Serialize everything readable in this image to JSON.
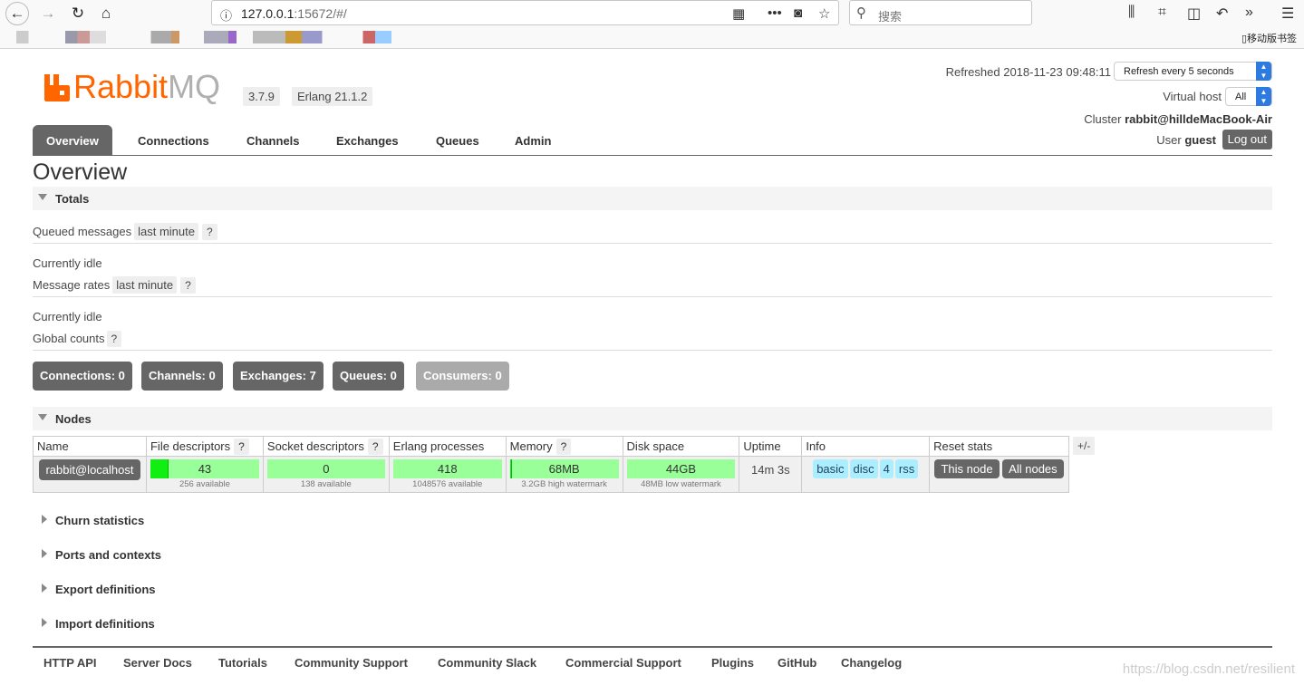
{
  "browser": {
    "url_host": "127.0.0.1",
    "url_rest": ":15672/#/",
    "search_placeholder": "搜索",
    "mobile_bookmarks": "移动版书签"
  },
  "header": {
    "brand": "Rabbit",
    "brand_suffix": "MQ",
    "version": "3.7.9",
    "erlang": "Erlang 21.1.2",
    "refreshed": "Refreshed 2018-11-23 09:48:11",
    "refresh_option": "Refresh every 5 seconds",
    "vhost_label": "Virtual host",
    "vhost_option": "All",
    "cluster_label": "Cluster ",
    "cluster_name": "rabbit@hilldeMacBook-Air",
    "user_label": "User ",
    "user_name": "guest",
    "logout": "Log out"
  },
  "tabs": [
    "Overview",
    "Connections",
    "Channels",
    "Exchanges",
    "Queues",
    "Admin"
  ],
  "page_title": "Overview",
  "totals": {
    "title": "Totals",
    "queued_label": "Queued messages",
    "queued_range": "last minute",
    "help": "?",
    "idle1": "Currently idle",
    "rates_label": "Message rates",
    "rates_range": "last minute",
    "idle2": "Currently idle",
    "global_label": "Global counts",
    "counts": {
      "connections": "Connections: ",
      "connections_v": "0",
      "channels": "Channels: ",
      "channels_v": "0",
      "exchanges": "Exchanges: ",
      "exchanges_v": "7",
      "queues": "Queues: ",
      "queues_v": "0",
      "consumers": "Consumers: ",
      "consumers_v": "0"
    }
  },
  "nodes": {
    "title": "Nodes",
    "headers": [
      "Name",
      "File descriptors",
      "Socket descriptors",
      "Erlang processes",
      "Memory",
      "Disk space",
      "Uptime",
      "Info",
      "Reset stats"
    ],
    "plusminus": "+/-",
    "row": {
      "name": "rabbit@localhost",
      "fd": "43",
      "fd_sub": "256 available",
      "fd_fraction": 0.17,
      "sd": "0",
      "sd_sub": "138 available",
      "sd_fraction": 0,
      "ep": "418",
      "ep_sub": "1048576 available",
      "ep_fraction": 0,
      "mem": "68MB",
      "mem_sub": "3.2GB high watermark",
      "mem_fraction": 0.02,
      "disk": "44GB",
      "disk_sub": "48MB low watermark",
      "disk_fraction": 0,
      "uptime": "14m 3s",
      "info": [
        "basic",
        "disc",
        "4",
        "rss"
      ],
      "reset_this": "This node",
      "reset_all": "All nodes"
    }
  },
  "collapsed": [
    "Churn statistics",
    "Ports and contexts",
    "Export definitions",
    "Import definitions"
  ],
  "footer": [
    "HTTP API",
    "Server Docs",
    "Tutorials",
    "Community Support",
    "Community Slack",
    "Commercial Support",
    "Plugins",
    "GitHub",
    "Changelog"
  ],
  "watermark": "https://blog.csdn.net/resilient",
  "colors": {
    "brand": "#ff6600",
    "tab_active": "#666666",
    "bar_bg": "#99ff99",
    "bar_fill": "#11ee11",
    "info_badge": "#aaeeff"
  }
}
